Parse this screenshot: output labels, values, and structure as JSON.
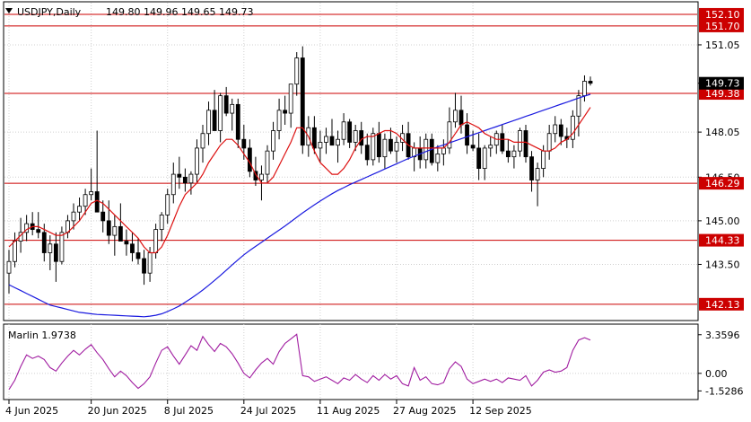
{
  "header": {
    "symbol": "USDJPY,Daily",
    "ohlc": "149.80 149.96 149.65 149.73",
    "indicator": "Marlin 1.9738"
  },
  "colors": {
    "level": "#cc0000",
    "ma_red": "#dd1111",
    "ma_blue": "#1a1adf",
    "oscillator": "#a01ca0",
    "tag_bg": "#cc0000",
    "current_bg": "#000000",
    "grid": "#d0d0d0"
  },
  "chart_data": [
    {
      "type": "candlestick",
      "title": "USDJPY,Daily",
      "y_range": [
        141.6,
        152.5
      ],
      "y_ticks": [
        "151.05",
        "149.73",
        "148.05",
        "146.50",
        "145.00",
        "143.50"
      ],
      "x_ticks": [
        "4 Jun 2025",
        "20 Jun 2025",
        "8 Jul 2025",
        "24 Jul 2025",
        "11 Aug 2025",
        "27 Aug 2025",
        "12 Sep 2025"
      ],
      "levels": [
        {
          "value": 152.1,
          "label": "152.10"
        },
        {
          "value": 151.7,
          "label": "151.70"
        },
        {
          "value": 149.38,
          "label": "149.38"
        },
        {
          "value": 146.29,
          "label": "146.29"
        },
        {
          "value": 144.33,
          "label": "144.33"
        },
        {
          "value": 142.13,
          "label": "142.13"
        }
      ],
      "current_price": {
        "value": 149.73,
        "label": "149.73"
      },
      "candles": [
        [
          143.2,
          144.0,
          142.5,
          143.6
        ],
        [
          143.6,
          144.6,
          143.4,
          144.3
        ],
        [
          144.3,
          145.1,
          143.9,
          144.6
        ],
        [
          144.6,
          145.2,
          144.3,
          144.9
        ],
        [
          144.9,
          145.3,
          144.5,
          144.7
        ],
        [
          144.7,
          145.3,
          144.4,
          144.6
        ],
        [
          144.6,
          144.9,
          143.6,
          143.9
        ],
        [
          143.9,
          144.5,
          143.3,
          144.2
        ],
        [
          144.2,
          144.6,
          142.9,
          143.6
        ],
        [
          143.6,
          144.8,
          143.5,
          144.6
        ],
        [
          144.6,
          145.2,
          144.4,
          145.0
        ],
        [
          145.0,
          145.6,
          144.7,
          145.3
        ],
        [
          145.3,
          145.8,
          145.0,
          145.5
        ],
        [
          145.5,
          146.1,
          145.2,
          145.9
        ],
        [
          145.9,
          146.8,
          145.7,
          146.0
        ],
        [
          146.0,
          148.1,
          145.5,
          145.3
        ],
        [
          145.3,
          145.7,
          144.6,
          145.0
        ],
        [
          145.0,
          145.7,
          144.2,
          144.5
        ],
        [
          144.5,
          145.2,
          143.8,
          144.8
        ],
        [
          144.8,
          145.6,
          144.4,
          144.3
        ],
        [
          144.3,
          144.7,
          143.8,
          144.2
        ],
        [
          144.2,
          144.6,
          143.6,
          143.9
        ],
        [
          143.9,
          144.4,
          143.5,
          143.7
        ],
        [
          143.7,
          144.0,
          142.8,
          143.2
        ],
        [
          143.2,
          144.1,
          142.9,
          143.9
        ],
        [
          143.9,
          144.9,
          143.7,
          144.7
        ],
        [
          144.7,
          145.3,
          144.3,
          145.2
        ],
        [
          145.2,
          146.1,
          144.9,
          145.9
        ],
        [
          145.9,
          147.0,
          145.6,
          146.6
        ],
        [
          146.6,
          147.2,
          146.1,
          146.5
        ],
        [
          146.5,
          146.8,
          146.0,
          146.3
        ],
        [
          146.3,
          146.7,
          145.9,
          146.6
        ],
        [
          146.6,
          147.8,
          146.3,
          147.5
        ],
        [
          147.5,
          148.3,
          147.0,
          148.0
        ],
        [
          148.0,
          149.1,
          147.6,
          148.8
        ],
        [
          148.8,
          149.5,
          148.2,
          148.1
        ],
        [
          148.1,
          149.4,
          147.7,
          149.3
        ],
        [
          149.3,
          149.6,
          148.6,
          148.7
        ],
        [
          148.7,
          149.2,
          148.1,
          149.0
        ],
        [
          149.0,
          149.2,
          147.5,
          147.8
        ],
        [
          147.8,
          148.3,
          147.1,
          147.5
        ],
        [
          147.5,
          147.8,
          146.5,
          146.7
        ],
        [
          146.7,
          147.2,
          146.2,
          146.4
        ],
        [
          146.4,
          146.9,
          145.7,
          146.6
        ],
        [
          146.6,
          147.6,
          146.3,
          147.4
        ],
        [
          147.4,
          148.4,
          147.1,
          148.1
        ],
        [
          148.1,
          149.2,
          147.8,
          148.8
        ],
        [
          148.8,
          149.3,
          148.3,
          148.7
        ],
        [
          148.7,
          149.4,
          148.2,
          149.7
        ],
        [
          149.7,
          150.8,
          149.3,
          150.6
        ],
        [
          150.6,
          151.0,
          147.3,
          147.6
        ],
        [
          147.6,
          148.6,
          147.2,
          148.2
        ],
        [
          148.2,
          148.6,
          147.3,
          147.5
        ],
        [
          147.5,
          148.1,
          147.0,
          147.7
        ],
        [
          147.7,
          148.2,
          147.3,
          147.9
        ],
        [
          147.9,
          148.5,
          147.6,
          147.6
        ],
        [
          147.6,
          148.1,
          147.0,
          147.8
        ],
        [
          147.8,
          148.7,
          147.6,
          148.4
        ],
        [
          148.4,
          148.5,
          147.5,
          147.7
        ],
        [
          147.7,
          148.3,
          147.4,
          148.1
        ],
        [
          148.1,
          148.4,
          147.3,
          147.6
        ],
        [
          147.6,
          148.0,
          146.9,
          147.1
        ],
        [
          147.1,
          148.2,
          146.9,
          148.0
        ],
        [
          148.0,
          148.4,
          147.0,
          147.2
        ],
        [
          147.2,
          148.0,
          146.8,
          147.8
        ],
        [
          147.8,
          148.2,
          147.3,
          147.4
        ],
        [
          147.4,
          147.9,
          147.0,
          147.7
        ],
        [
          147.7,
          148.3,
          147.4,
          148.0
        ],
        [
          148.0,
          148.4,
          147.1,
          147.2
        ],
        [
          147.2,
          147.7,
          146.7,
          147.5
        ],
        [
          147.5,
          147.9,
          146.8,
          147.1
        ],
        [
          147.1,
          148.0,
          146.8,
          147.8
        ],
        [
          147.8,
          148.0,
          146.9,
          147.0
        ],
        [
          147.0,
          147.6,
          146.7,
          147.3
        ],
        [
          147.3,
          147.8,
          146.9,
          147.5
        ],
        [
          147.5,
          148.9,
          147.3,
          148.4
        ],
        [
          148.4,
          149.4,
          148.2,
          148.8
        ],
        [
          148.8,
          149.3,
          148.0,
          148.3
        ],
        [
          148.3,
          148.7,
          147.3,
          147.6
        ],
        [
          147.6,
          148.1,
          147.4,
          147.5
        ],
        [
          147.5,
          148.0,
          146.4,
          146.8
        ],
        [
          146.8,
          147.6,
          146.4,
          147.5
        ],
        [
          147.5,
          147.9,
          147.2,
          147.6
        ],
        [
          147.6,
          148.1,
          147.3,
          148.0
        ],
        [
          148.0,
          148.3,
          147.3,
          147.4
        ],
        [
          147.4,
          147.8,
          147.0,
          147.2
        ],
        [
          147.2,
          147.6,
          146.8,
          147.4
        ],
        [
          147.4,
          148.2,
          147.2,
          148.1
        ],
        [
          148.1,
          148.3,
          147.0,
          147.2
        ],
        [
          147.2,
          147.4,
          146.0,
          146.4
        ],
        [
          146.4,
          147.0,
          145.5,
          146.8
        ],
        [
          146.8,
          147.6,
          146.5,
          147.4
        ],
        [
          147.4,
          148.3,
          147.1,
          148.0
        ],
        [
          148.0,
          148.6,
          147.7,
          148.3
        ],
        [
          148.3,
          148.5,
          147.6,
          147.9
        ],
        [
          147.9,
          148.2,
          147.5,
          147.8
        ],
        [
          147.8,
          148.8,
          147.5,
          148.6
        ],
        [
          148.6,
          149.5,
          147.9,
          149.3
        ],
        [
          149.3,
          150.0,
          149.1,
          149.8
        ],
        [
          149.8,
          149.96,
          149.65,
          149.73
        ]
      ],
      "ma_fast": [
        144.1,
        144.3,
        144.5,
        144.7,
        144.8,
        144.8,
        144.7,
        144.6,
        144.5,
        144.5,
        144.6,
        144.8,
        145.0,
        145.3,
        145.6,
        145.7,
        145.6,
        145.4,
        145.2,
        145.0,
        144.8,
        144.6,
        144.4,
        144.1,
        143.9,
        143.9,
        144.1,
        144.5,
        145.0,
        145.5,
        145.9,
        146.1,
        146.3,
        146.6,
        147.0,
        147.3,
        147.6,
        147.8,
        147.8,
        147.6,
        147.3,
        147.0,
        146.6,
        146.3,
        146.3,
        146.5,
        146.9,
        147.3,
        147.7,
        148.2,
        148.2,
        147.9,
        147.4,
        147.0,
        146.8,
        146.6,
        146.6,
        146.8,
        147.1,
        147.5,
        147.8,
        147.9,
        147.9,
        148.0,
        148.1,
        148.1,
        148.0,
        147.8,
        147.6,
        147.5,
        147.5,
        147.5,
        147.5,
        147.5,
        147.5,
        147.7,
        148.0,
        148.3,
        148.4,
        148.3,
        148.2,
        148.0,
        147.9,
        147.8,
        147.8,
        147.8,
        147.7,
        147.7,
        147.7,
        147.6,
        147.5,
        147.4,
        147.4,
        147.5,
        147.7,
        147.8,
        148.0,
        148.3,
        148.6,
        148.9
      ],
      "ma_slow": [
        142.8,
        142.7,
        142.6,
        142.5,
        142.4,
        142.3,
        142.2,
        142.1,
        142.05,
        142.0,
        141.95,
        141.9,
        141.85,
        141.83,
        141.8,
        141.78,
        141.77,
        141.76,
        141.75,
        141.74,
        141.73,
        141.72,
        141.71,
        141.7,
        141.72,
        141.75,
        141.8,
        141.88,
        141.97,
        142.07,
        142.2,
        142.33,
        142.47,
        142.62,
        142.78,
        142.95,
        143.12,
        143.3,
        143.48,
        143.66,
        143.83,
        143.98,
        144.12,
        144.26,
        144.4,
        144.54,
        144.68,
        144.82,
        144.97,
        145.12,
        145.27,
        145.41,
        145.55,
        145.68,
        145.81,
        145.93,
        146.04,
        146.14,
        146.24,
        146.33,
        146.42,
        146.51,
        146.6,
        146.69,
        146.78,
        146.87,
        146.96,
        147.05,
        147.14,
        147.22,
        147.3,
        147.38,
        147.46,
        147.54,
        147.61,
        147.68,
        147.75,
        147.82,
        147.89,
        147.96,
        148.03,
        148.1,
        148.17,
        148.24,
        148.31,
        148.38,
        148.45,
        148.52,
        148.59,
        148.66,
        148.73,
        148.8,
        148.87,
        148.94,
        149.01,
        149.08,
        149.15,
        149.22,
        149.29,
        149.35
      ]
    },
    {
      "type": "line",
      "title": "Marlin 1.9738",
      "y_range": [
        -2.2,
        4.2
      ],
      "y_ticks": [
        "3.3596",
        "0.00",
        "-1.5286"
      ],
      "series": [
        {
          "name": "Marlin",
          "values": [
            -1.4,
            -0.6,
            0.6,
            1.6,
            1.3,
            1.5,
            1.2,
            0.5,
            0.2,
            0.9,
            1.5,
            2.0,
            1.6,
            2.1,
            2.5,
            1.8,
            1.2,
            0.4,
            -0.3,
            0.2,
            -0.2,
            -0.8,
            -1.3,
            -0.9,
            -0.3,
            0.9,
            2.0,
            2.3,
            1.5,
            0.8,
            1.6,
            2.4,
            2.0,
            3.2,
            2.5,
            1.9,
            2.6,
            2.3,
            1.7,
            0.9,
            0.0,
            -0.4,
            0.3,
            0.9,
            1.3,
            0.8,
            1.9,
            2.6,
            3.0,
            3.4,
            -0.2,
            -0.3,
            -0.7,
            -0.5,
            -0.3,
            -0.6,
            -0.9,
            -0.4,
            -0.6,
            -0.1,
            -0.5,
            -0.8,
            -0.2,
            -0.6,
            -0.1,
            -0.5,
            -0.2,
            -0.9,
            -1.1,
            0.5,
            -0.6,
            -0.3,
            -0.9,
            -1.0,
            -0.8,
            0.4,
            1.0,
            0.6,
            -0.5,
            -0.9,
            -0.7,
            -0.5,
            -0.7,
            -0.5,
            -0.8,
            -0.4,
            -0.5,
            -0.6,
            -0.2,
            -1.1,
            -0.6,
            0.1,
            0.3,
            0.1,
            0.2,
            0.5,
            2.0,
            2.9,
            3.1,
            2.9
          ]
        }
      ]
    }
  ]
}
